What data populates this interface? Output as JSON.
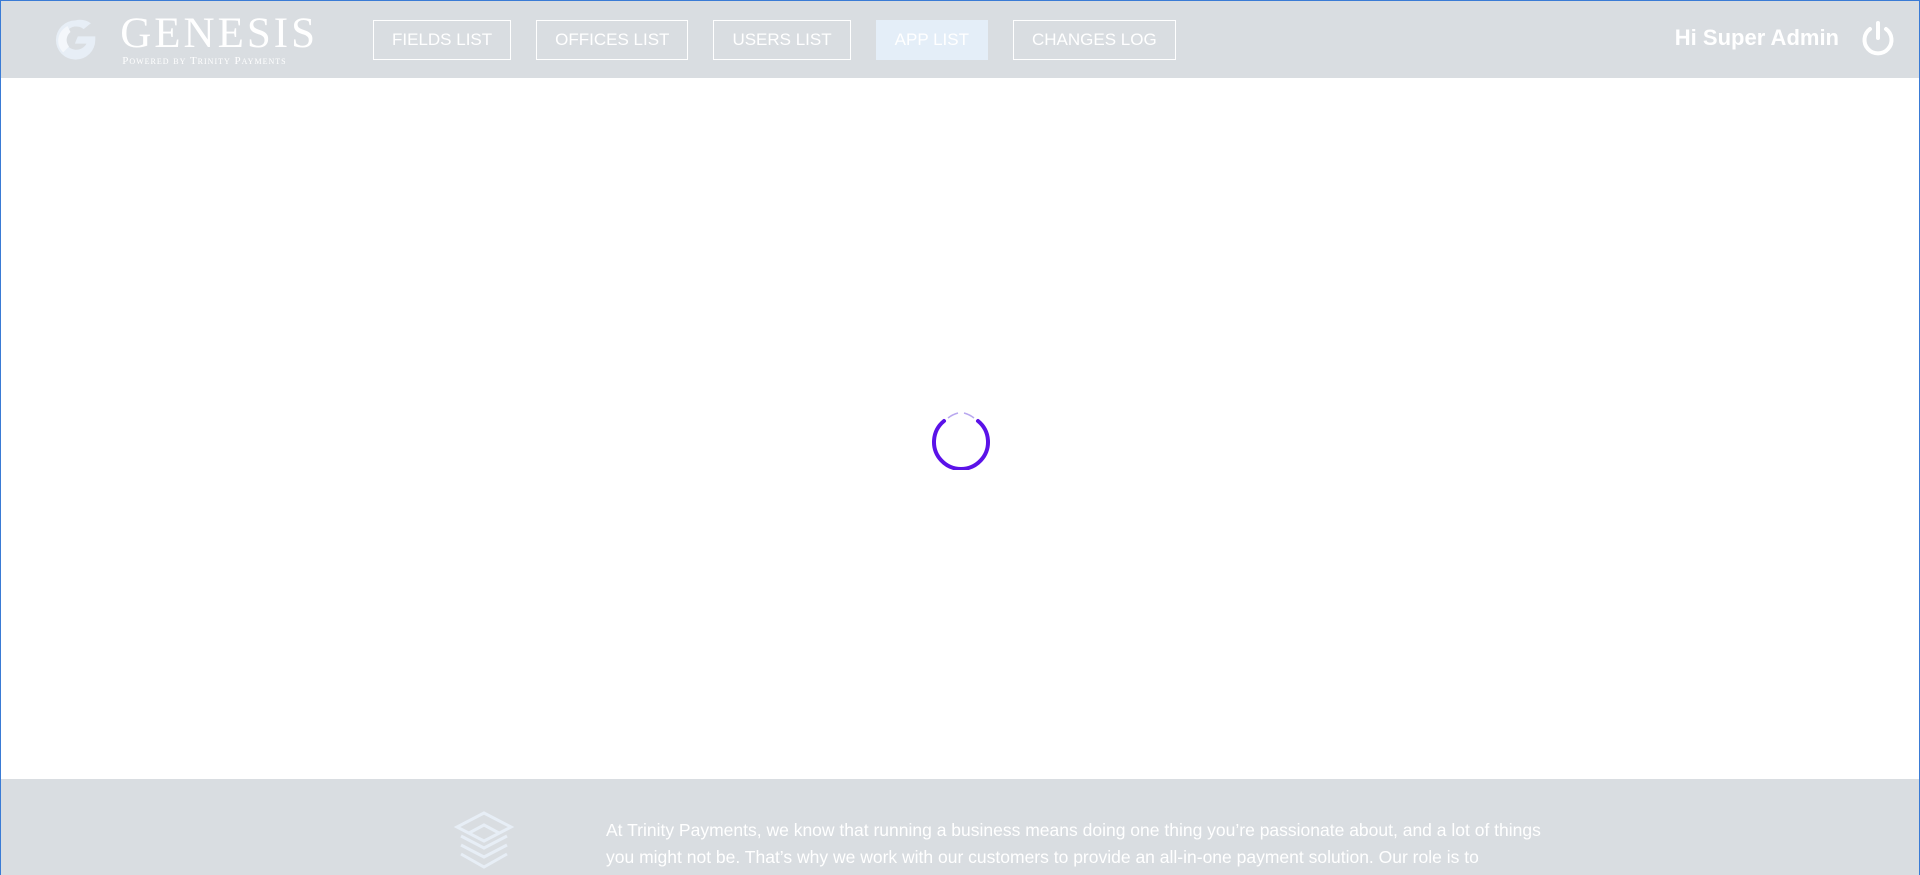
{
  "brand": {
    "name": "GENESIS",
    "tagline": "Powered by Trinity Payments"
  },
  "nav": {
    "items": [
      {
        "label": "FIELDS LIST"
      },
      {
        "label": "OFFICES LIST"
      },
      {
        "label": "USERS LIST"
      },
      {
        "label": "APP LIST",
        "active": true
      },
      {
        "label": "CHANGES LOG"
      }
    ]
  },
  "user": {
    "greeting": "Hi Super Admin"
  },
  "footer": {
    "text": "At Trinity Payments, we know that running a business means doing one thing you’re passionate about, and a lot of things you might not be. That’s why we work with our customers to provide an all-in-one payment solution. Our role is to"
  },
  "colors": {
    "bar": "#d9dde1",
    "spinner": "#5b12e8",
    "active_tab": "#e4eef8"
  }
}
